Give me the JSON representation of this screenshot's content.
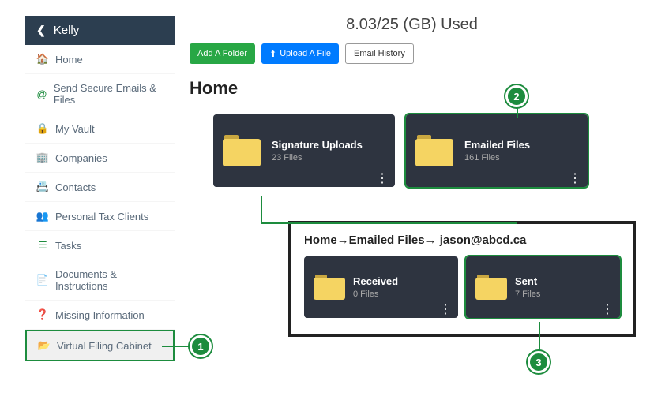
{
  "sidebar": {
    "user": "Kelly",
    "items": [
      {
        "label": "Home"
      },
      {
        "label": "Send Secure Emails & Files"
      },
      {
        "label": "My Vault"
      },
      {
        "label": "Companies"
      },
      {
        "label": "Contacts"
      },
      {
        "label": "Personal Tax Clients"
      },
      {
        "label": "Tasks"
      },
      {
        "label": "Documents & Instructions"
      },
      {
        "label": "Missing Information"
      },
      {
        "label": "Virtual Filing Cabinet"
      }
    ]
  },
  "storage_text": "8.03/25 (GB) Used",
  "toolbar": {
    "add_folder": "Add A Folder",
    "upload_file": "Upload A File",
    "email_history": "Email History"
  },
  "page_title": "Home",
  "folders": [
    {
      "name": "Signature Uploads",
      "count": "23 Files"
    },
    {
      "name": "Emailed Files",
      "count": "161 Files"
    }
  ],
  "breadcrumb": "Home→Emailed Files→ jason@abcd.ca",
  "sub_folders": [
    {
      "name": "Received",
      "count": "0 Files"
    },
    {
      "name": "Sent",
      "count": "7 Files"
    }
  ],
  "steps": {
    "s1": "1",
    "s2": "2",
    "s3": "3"
  }
}
